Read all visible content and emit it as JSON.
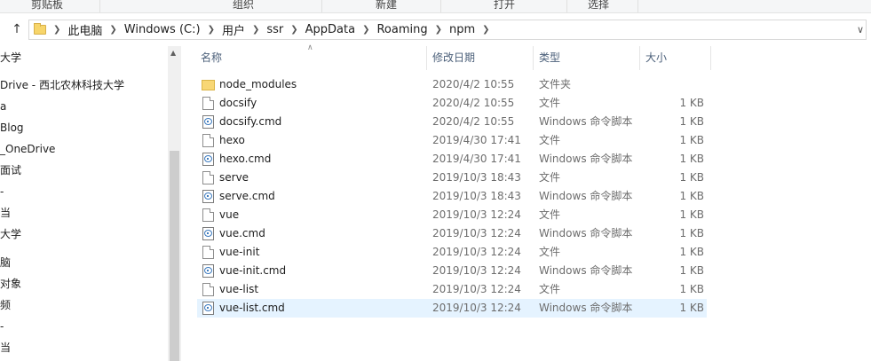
{
  "ribbon": {
    "groups": [
      "剪贴板",
      "组织",
      "新建",
      "打开",
      "选择"
    ]
  },
  "address": {
    "breadcrumbs": [
      "此电脑",
      "Windows (C:)",
      "用户",
      "ssr",
      "AppData",
      "Roaming",
      "npm"
    ]
  },
  "nav": {
    "items": [
      "大学",
      "Drive - 西北农林科技大学",
      "a",
      "Blog",
      "_OneDrive",
      "面试",
      "-",
      "当",
      "大学",
      "脑",
      "对象",
      "频",
      "-",
      "当"
    ]
  },
  "columns": {
    "name": "名称",
    "date": "修改日期",
    "type": "类型",
    "size": "大小"
  },
  "files": [
    {
      "name": "node_modules",
      "date": "2020/4/2 10:55",
      "type": "文件夹",
      "size": "",
      "icon": "folder-icon"
    },
    {
      "name": "docsify",
      "date": "2020/4/2 10:55",
      "type": "文件",
      "size": "1 KB",
      "icon": "file-icon"
    },
    {
      "name": "docsify.cmd",
      "date": "2020/4/2 10:55",
      "type": "Windows 命令脚本",
      "size": "1 KB",
      "icon": "cmd-file-icon"
    },
    {
      "name": "hexo",
      "date": "2019/4/30 17:41",
      "type": "文件",
      "size": "1 KB",
      "icon": "file-icon"
    },
    {
      "name": "hexo.cmd",
      "date": "2019/4/30 17:41",
      "type": "Windows 命令脚本",
      "size": "1 KB",
      "icon": "cmd-file-icon"
    },
    {
      "name": "serve",
      "date": "2019/10/3 18:43",
      "type": "文件",
      "size": "1 KB",
      "icon": "file-icon"
    },
    {
      "name": "serve.cmd",
      "date": "2019/10/3 18:43",
      "type": "Windows 命令脚本",
      "size": "1 KB",
      "icon": "cmd-file-icon"
    },
    {
      "name": "vue",
      "date": "2019/10/3 12:24",
      "type": "文件",
      "size": "1 KB",
      "icon": "file-icon"
    },
    {
      "name": "vue.cmd",
      "date": "2019/10/3 12:24",
      "type": "Windows 命令脚本",
      "size": "1 KB",
      "icon": "cmd-file-icon"
    },
    {
      "name": "vue-init",
      "date": "2019/10/3 12:24",
      "type": "文件",
      "size": "1 KB",
      "icon": "file-icon"
    },
    {
      "name": "vue-init.cmd",
      "date": "2019/10/3 12:24",
      "type": "Windows 命令脚本",
      "size": "1 KB",
      "icon": "cmd-file-icon"
    },
    {
      "name": "vue-list",
      "date": "2019/10/3 12:24",
      "type": "文件",
      "size": "1 KB",
      "icon": "file-icon"
    },
    {
      "name": "vue-list.cmd",
      "date": "2019/10/3 12:24",
      "type": "Windows 命令脚本",
      "size": "1 KB",
      "icon": "cmd-file-icon",
      "selected": true
    }
  ]
}
